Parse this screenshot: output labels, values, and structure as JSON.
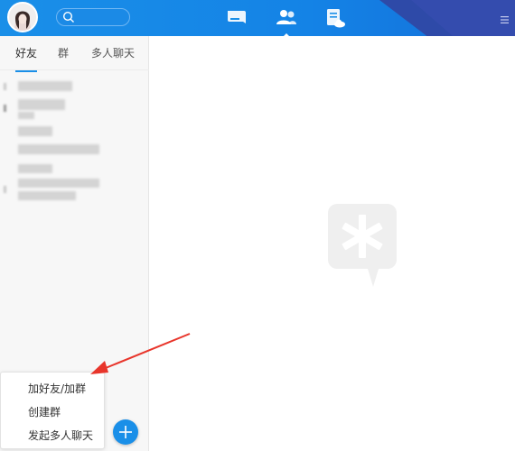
{
  "header": {
    "search_placeholder": "",
    "nav": [
      {
        "icon": "chat-icon"
      },
      {
        "icon": "contacts-icon"
      },
      {
        "icon": "cloud-document-icon"
      }
    ],
    "menu_icon": "hamburger-menu-icon"
  },
  "sidebar": {
    "tabs": [
      "好友",
      "群",
      "多人聊天"
    ],
    "active_tab": 0
  },
  "popup_menu": {
    "items": [
      "加好友/加群",
      "创建群",
      "发起多人聊天"
    ]
  },
  "main": {
    "placeholder_icon": "app-logo-icon"
  },
  "colors": {
    "topbar": "#1a8fe8",
    "corner": "#2e4aa8",
    "accent": "#1a8fe8",
    "arrow": "#e8352b"
  }
}
